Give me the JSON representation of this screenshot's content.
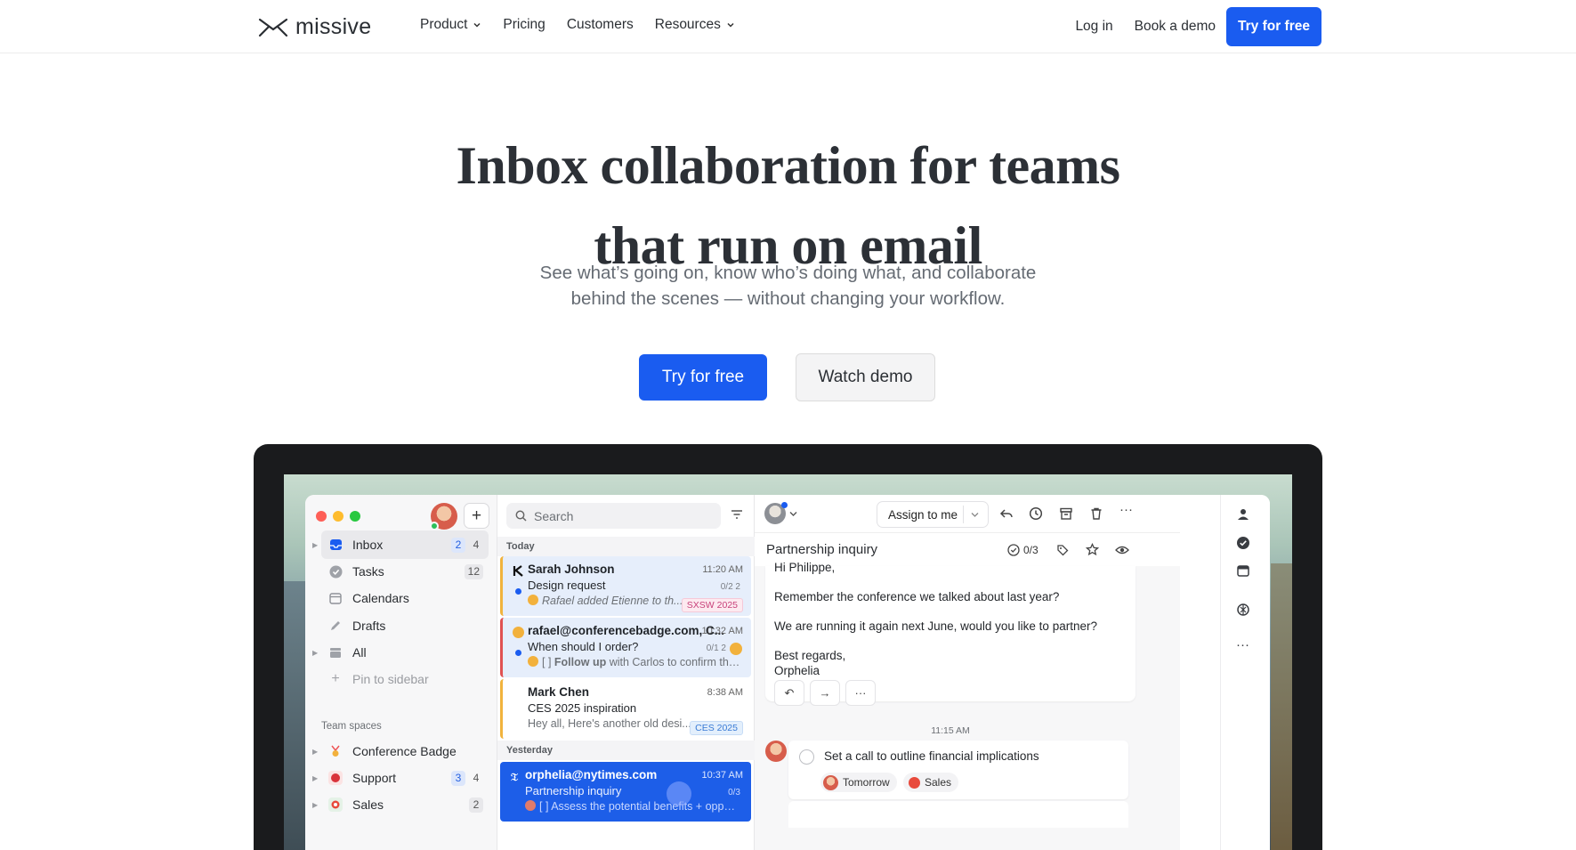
{
  "nav": {
    "logo_text": "missive",
    "links": [
      {
        "label": "Product",
        "has_menu": true
      },
      {
        "label": "Pricing",
        "has_menu": false
      },
      {
        "label": "Customers",
        "has_menu": false
      },
      {
        "label": "Resources",
        "has_menu": true
      }
    ],
    "login": "Log in",
    "book_demo": "Book a demo",
    "try_free": "Try for free"
  },
  "hero": {
    "title_line1": "Inbox collaboration for teams",
    "title_line2": "that run on email",
    "subtitle_line1": "See what’s going on, know who’s doing what, and collaborate",
    "subtitle_line2": "behind the scenes — without changing your workflow.",
    "cta_primary": "Try for free",
    "cta_secondary": "Watch demo"
  },
  "colors": {
    "accent": "#1a5cf0",
    "device": "#1a1b1d",
    "selected_mail": "#1d5ee8"
  },
  "app": {
    "sidebar": {
      "items": [
        {
          "label": "Inbox",
          "icon": "inbox-icon",
          "counts": [
            "2",
            "4"
          ]
        },
        {
          "label": "Tasks",
          "icon": "check-circle-icon",
          "counts": [
            "12"
          ]
        },
        {
          "label": "Calendars",
          "icon": "calendar-icon",
          "counts": []
        },
        {
          "label": "Drafts",
          "icon": "pencil-icon",
          "counts": []
        },
        {
          "label": "All",
          "icon": "stack-icon",
          "counts": []
        },
        {
          "label": "Pin to sidebar",
          "icon": "plus-icon",
          "counts": []
        }
      ],
      "team_spaces_title": "Team spaces",
      "team_spaces": [
        {
          "label": "Conference Badge",
          "icon": "badge-icon",
          "counts": []
        },
        {
          "label": "Support",
          "icon": "support-icon",
          "counts": [
            "3",
            "4"
          ]
        },
        {
          "label": "Sales",
          "icon": "sales-icon",
          "counts": [
            "2"
          ]
        }
      ]
    },
    "list": {
      "search_placeholder": "Search",
      "day_today": "Today",
      "day_yesterday": "Yesterday",
      "mails": [
        {
          "from": "Sarah Johnson",
          "time": "11:20 AM",
          "subject": "Design request",
          "preview": "Rafael added Etienne to th...",
          "tag": "SXSW 2025",
          "meta": "0/2   2"
        },
        {
          "from": "rafael@conferencebadge.com, C...",
          "time": "10:32 AM",
          "subject": "When should I order?",
          "preview_prefix": "[ ] ",
          "preview_bold": "Follow up",
          "preview": " with Carlos to confirm the ...",
          "meta": "0/1   2"
        },
        {
          "from": "Mark Chen",
          "time": "8:38 AM",
          "subject": "CES 2025 inspiration",
          "preview": "Hey all, Here's another old desi...",
          "tag": "CES 2025"
        },
        {
          "from": "orphelia@nytimes.com",
          "time": "10:37 AM",
          "subject": "Partnership inquiry",
          "preview": "[ ] Assess the potential benefits + oppor...",
          "meta": "0/3"
        }
      ]
    },
    "conversation": {
      "assign_label": "Assign to me",
      "title": "Partnership inquiry",
      "task_count": "0/3",
      "message_lines": [
        "Hi Philippe,",
        "Remember the conference we talked about last year?",
        "We are running it again next June, would you like to partner?",
        "Best regards,",
        "Orphelia"
      ],
      "timestamp": "11:15 AM",
      "task": "Set a call to outline financial implications",
      "chip_due": "Tomorrow",
      "chip_team": "Sales"
    }
  }
}
